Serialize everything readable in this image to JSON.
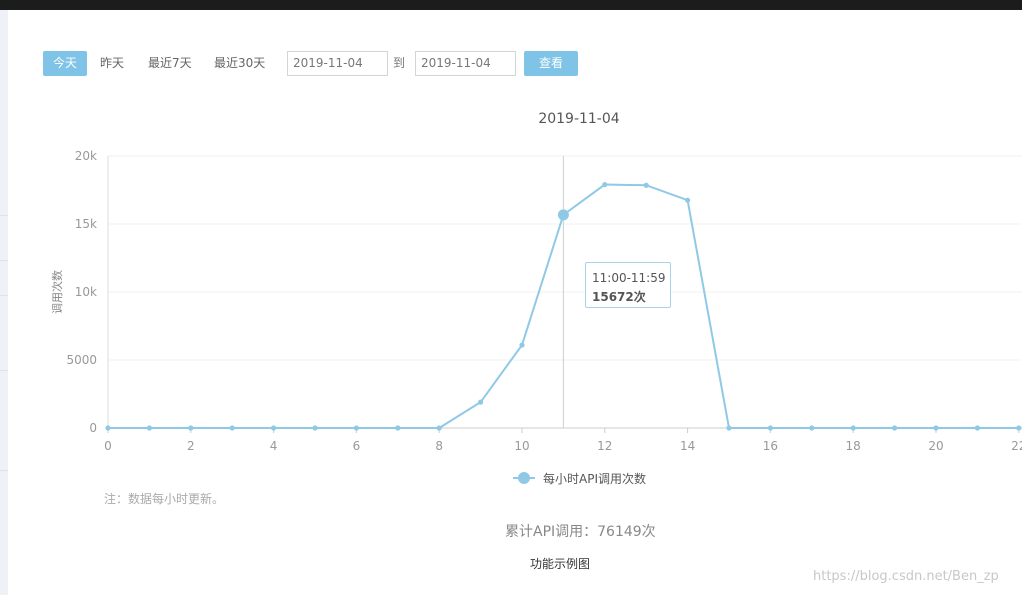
{
  "toolbar": {
    "today": "今天",
    "yesterday": "昨天",
    "last7": "最近7天",
    "last30": "最近30天",
    "start_date": "2019-11-04",
    "to_label": "到",
    "end_date": "2019-11-04",
    "view_button": "查看"
  },
  "tooltip": {
    "time_range": "11:00-11:59",
    "value": "15672次"
  },
  "note": "注：数据每小时更新。",
  "total": "累计API调用：76149次",
  "caption": "功能示例图",
  "watermark": "https://blog.csdn.net/Ben_zp",
  "colors": {
    "accent": "#7fc3e6",
    "series": "#8fc9e6"
  },
  "chart_data": {
    "type": "line",
    "title": "2019-11-04",
    "ylabel": "调用次数",
    "xlabel": "",
    "x": [
      0,
      1,
      2,
      3,
      4,
      5,
      6,
      7,
      8,
      9,
      10,
      11,
      12,
      13,
      14,
      15,
      16,
      17,
      18,
      19,
      20,
      21,
      22
    ],
    "x_tick_labels": [
      "0",
      "2",
      "4",
      "6",
      "8",
      "10",
      "12",
      "14",
      "16",
      "18",
      "20",
      "22"
    ],
    "y_tick_labels": [
      "0",
      "5000",
      "10k",
      "15k",
      "20k"
    ],
    "ylim": [
      0,
      20000
    ],
    "grid": true,
    "legend_position": "bottom",
    "highlight_index": 11,
    "series": [
      {
        "name": "每小时API调用次数",
        "values": [
          0,
          0,
          0,
          0,
          0,
          0,
          0,
          0,
          0,
          1900,
          6100,
          15672,
          17900,
          17850,
          16750,
          0,
          0,
          0,
          0,
          0,
          0,
          0,
          0
        ]
      }
    ]
  }
}
